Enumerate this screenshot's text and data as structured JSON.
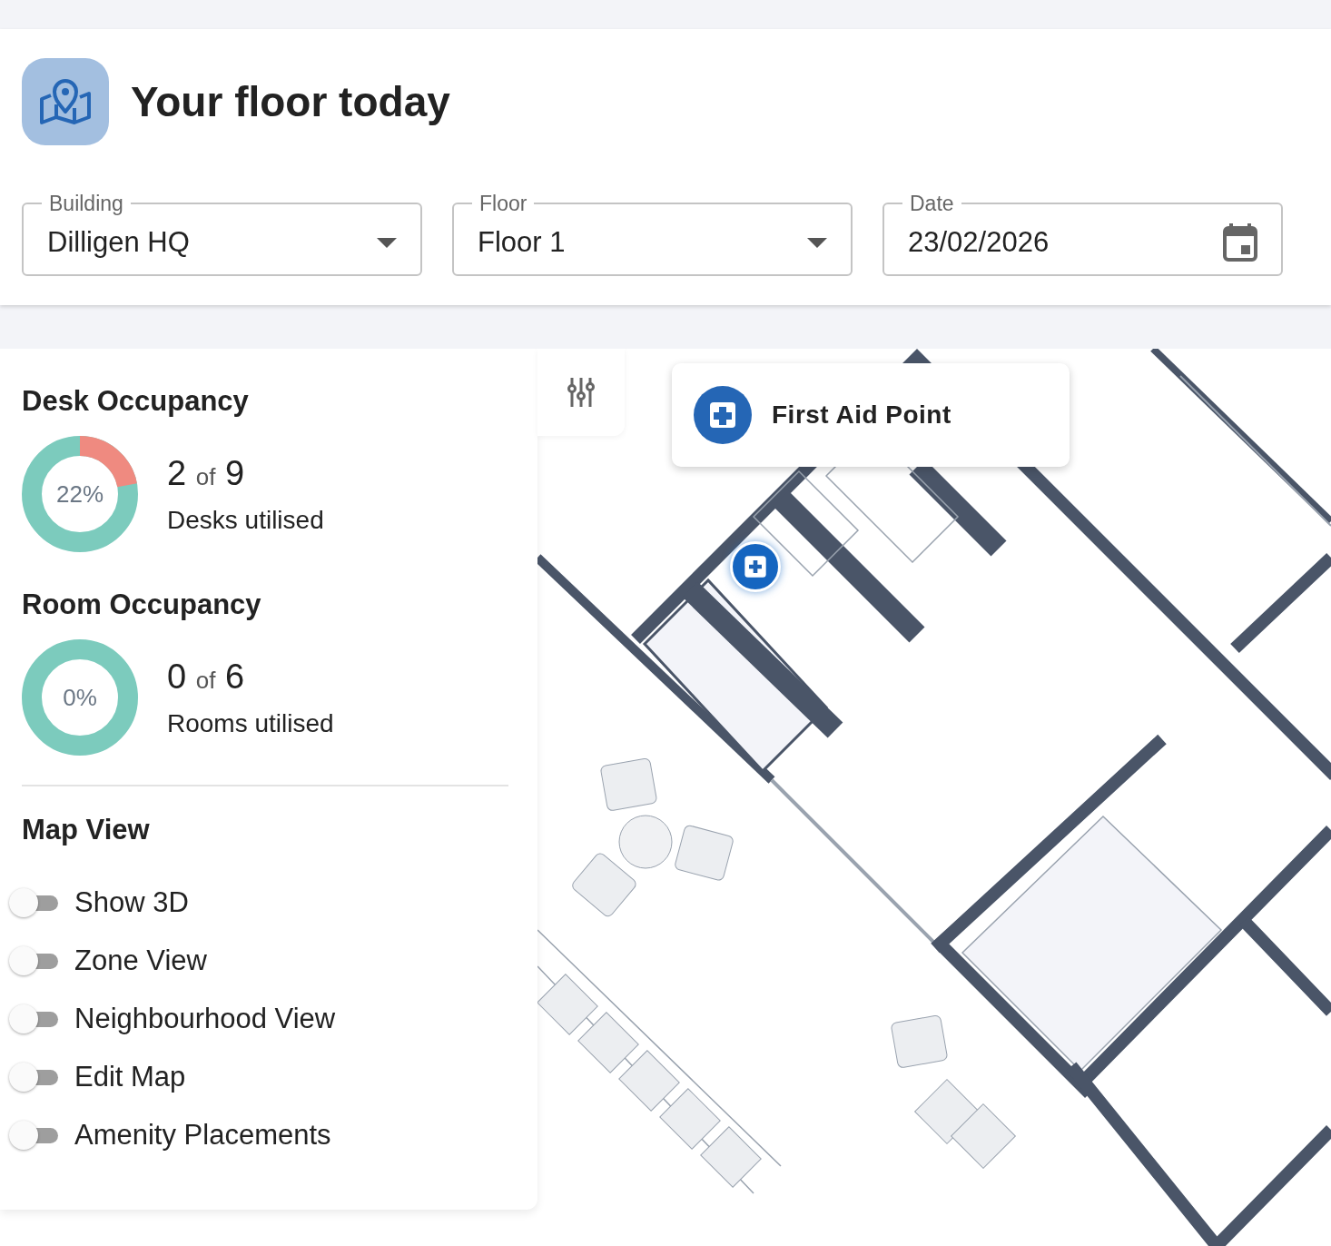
{
  "header": {
    "title": "Your floor today"
  },
  "filters": [
    {
      "kind": "select",
      "label": "Building",
      "value": "Dilligen HQ"
    },
    {
      "kind": "select",
      "label": "Floor",
      "value": "Floor 1"
    },
    {
      "kind": "date",
      "label": "Date",
      "value": "23/02/2026"
    }
  ],
  "occupancy": [
    {
      "title": "Desk Occupancy",
      "percent": "22%",
      "level": 0.22,
      "used": "2",
      "of": "of",
      "total": "9",
      "caption": "Desks utilised"
    },
    {
      "title": "Room Occupancy",
      "percent": "0%",
      "level": 0,
      "used": "0",
      "of": "of",
      "total": "6",
      "caption": "Rooms utilised"
    }
  ],
  "map_view": {
    "title": "Map View",
    "toggles": [
      {
        "label": "Show 3D",
        "on": false
      },
      {
        "label": "Zone View",
        "on": false
      },
      {
        "label": "Neighbourhood View",
        "on": false
      },
      {
        "label": "Edit Map",
        "on": false
      },
      {
        "label": "Amenity Placements",
        "on": false
      }
    ]
  },
  "map": {
    "popup": {
      "title": "First Aid Point"
    }
  }
}
